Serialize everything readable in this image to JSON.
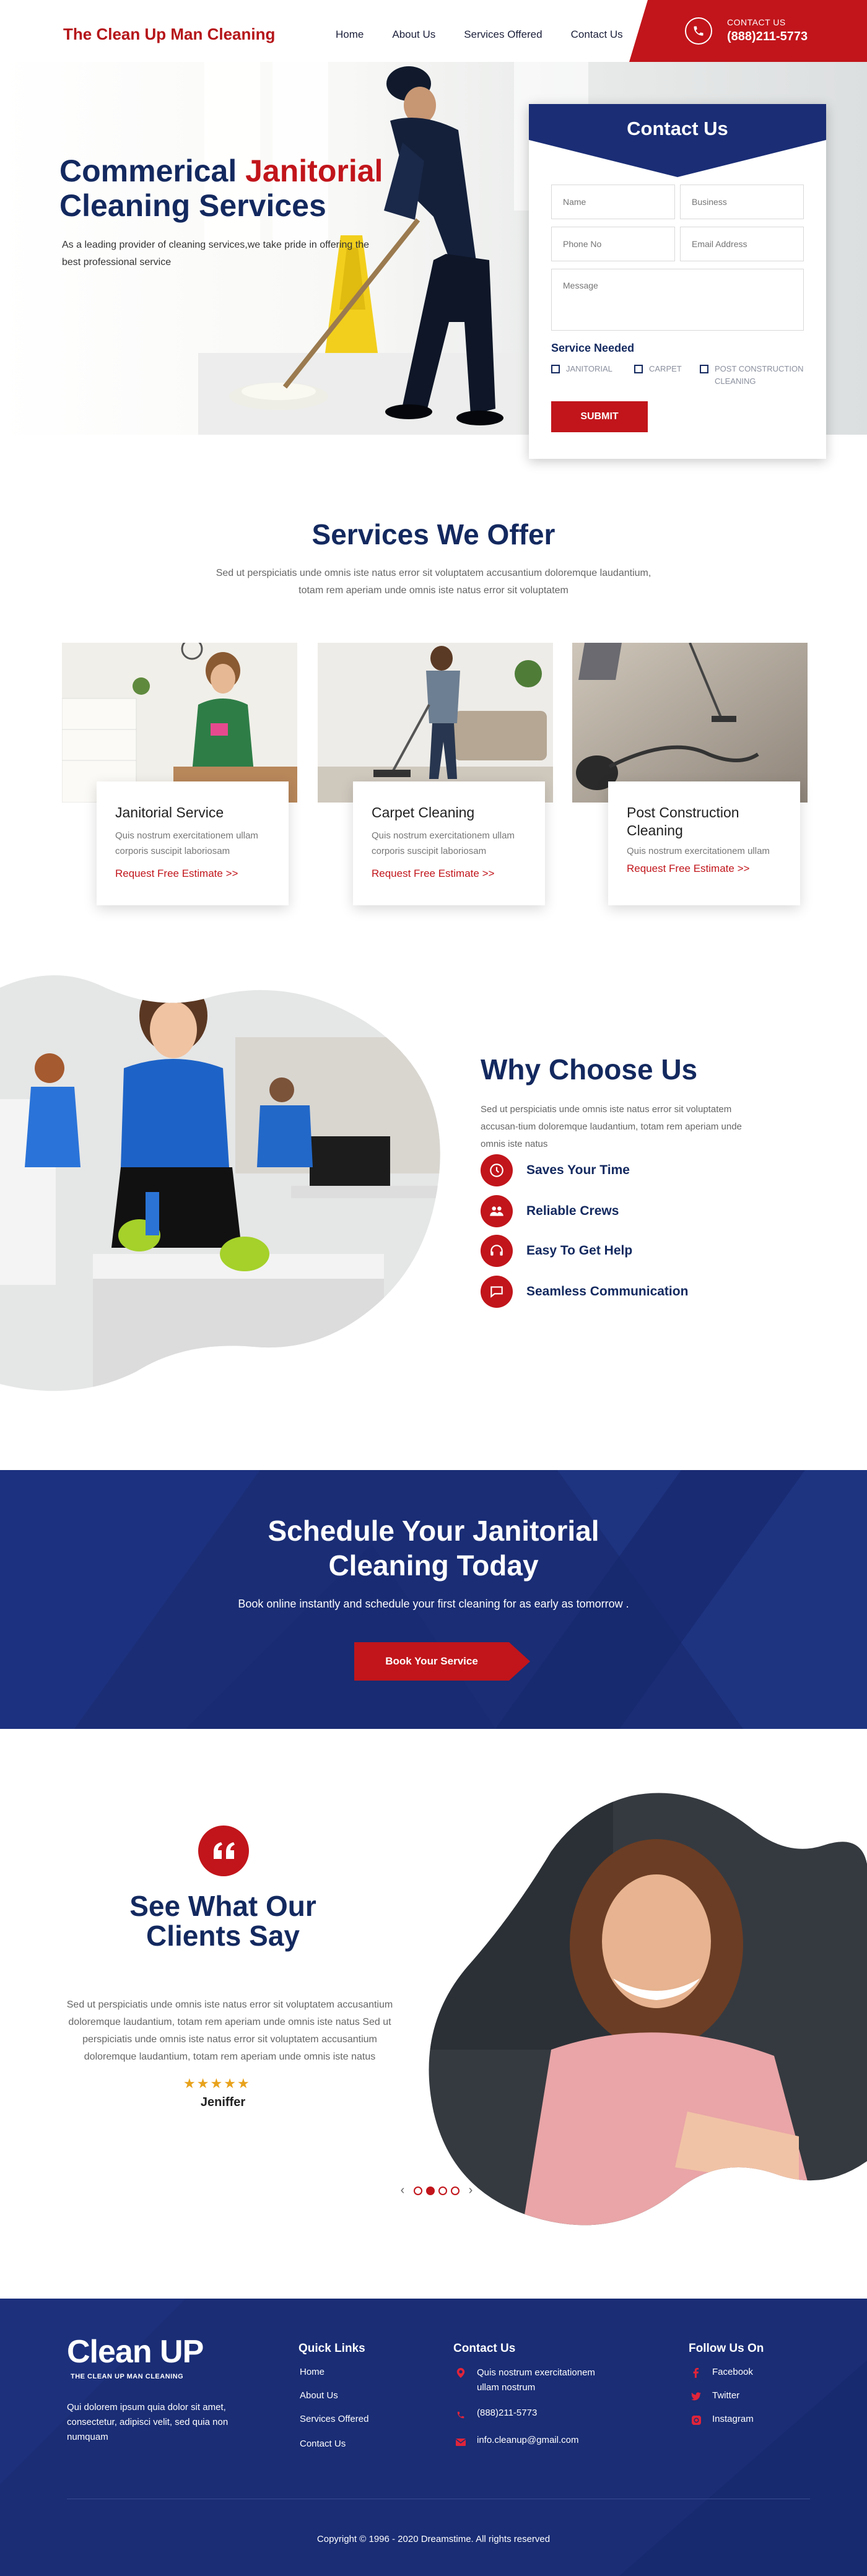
{
  "header": {
    "logo": "The Clean Up Man Cleaning",
    "nav": [
      "Home",
      "About Us",
      "Services Offered",
      "Contact Us"
    ],
    "contact_label": "CONTACT US",
    "phone": "(888)211-5773"
  },
  "hero": {
    "title_part1": "Commerical ",
    "title_highlight": "Janitorial",
    "title_part2": "Cleaning Services",
    "subtitle": "As a leading provider of cleaning services,we take pride in offering the best professional service"
  },
  "contact_form": {
    "title": "Contact Us",
    "placeholders": {
      "name": "Name",
      "business": "Business",
      "phone": "Phone No",
      "email": "Email Address",
      "message": "Message"
    },
    "service_needed_label": "Service Needed",
    "options": [
      "JANITORIAL",
      "CARPET",
      "POST CONSTRUCTION CLEANING"
    ],
    "submit": "SUBMIT"
  },
  "services": {
    "title": "Services We Offer",
    "description": "Sed ut perspiciatis unde omnis iste natus error sit voluptatem accusantium doloremque laudantium, totam rem aperiam unde omnis iste natus error sit voluptatem",
    "cards": [
      {
        "title": "Janitorial Service",
        "text": "Quis nostrum exercitationem ullam corporis suscipit laboriosam",
        "link": "Request Free Estimate >>"
      },
      {
        "title": "Carpet Cleaning",
        "text": "Quis nostrum exercitationem ullam corporis suscipit laboriosam",
        "link": "Request Free Estimate >>"
      },
      {
        "title": "Post Construction Cleaning",
        "text": "Quis nostrum exercitationem ullam",
        "link": "Request Free Estimate >>"
      }
    ]
  },
  "why": {
    "title": "Why Choose Us",
    "description": "Sed ut perspiciatis unde omnis iste natus error sit voluptatem accusan-tium doloremque laudantium, totam rem aperiam unde omnis iste natus",
    "items": [
      "Saves Your Time",
      "Reliable Crews",
      "Easy To Get Help",
      "Seamless Communication"
    ]
  },
  "schedule": {
    "title_line1": "Schedule Your Janitorial",
    "title_line2": "Cleaning Today",
    "subtitle": "Book online instantly and schedule your first cleaning for as early as tomorrow .",
    "button": "Book Your Service"
  },
  "testimonial": {
    "title_line1": "See What Our",
    "title_line2": "Clients Say",
    "text": "Sed ut perspiciatis unde omnis iste natus error sit voluptatem accusantium doloremque laudantium, totam rem aperiam unde omnis iste natus Sed ut perspiciatis unde omnis iste natus error sit voluptatem accusantium doloremque laudantium, totam rem aperiam unde omnis iste natus",
    "stars": 5,
    "name": "Jeniffer",
    "slide_count": 4,
    "active_slide": 2
  },
  "footer": {
    "logo": "Clean UP",
    "logo_sub": "THE CLEAN UP MAN CLEANING",
    "about": "Qui dolorem ipsum quia dolor sit amet, consectetur, adipisci velit, sed quia non numquam",
    "quick_links_title": "Quick Links",
    "quick_links": [
      "Home",
      "About Us",
      "Services Offered",
      "Contact Us"
    ],
    "contact_title": "Contact Us",
    "address": "Quis nostrum exercitationem ullam nostrum",
    "phone": "(888)211-5773",
    "email": "info.cleanup@gmail.com",
    "follow_title": "Follow Us On",
    "social": [
      "Facebook",
      "Twitter",
      "Instagram"
    ],
    "copyright": "Copyright © 1996 - 2020 Dreamstime. All rights reserved"
  },
  "colors": {
    "brand_red": "#c1151b",
    "navy": "#13295f",
    "footer_blue": "#1a2d75",
    "star": "#e8a21b"
  }
}
